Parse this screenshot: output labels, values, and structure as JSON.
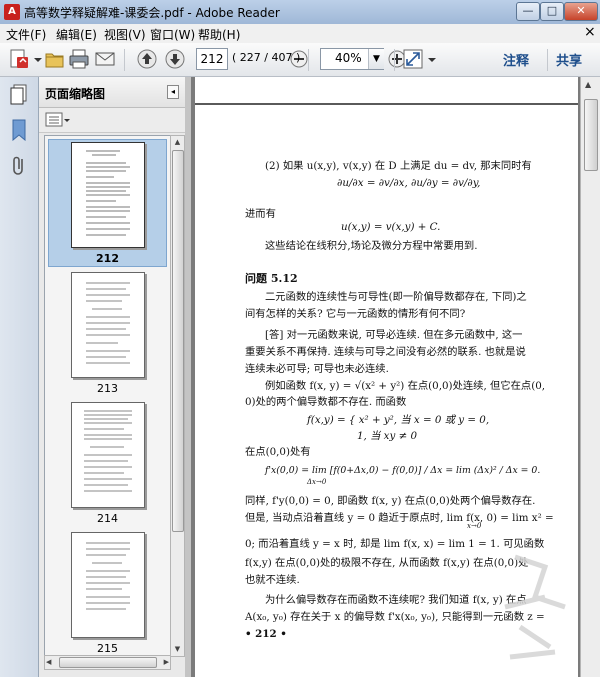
{
  "window": {
    "title": "高等数学释疑解难-课委会.pdf - Adobe Reader",
    "controls": {
      "minimize": "—",
      "maximize": "□",
      "close": "✕"
    }
  },
  "menubar": {
    "items": [
      "文件(F)",
      "编辑(E)",
      "视图(V)",
      "窗口(W)",
      "帮助(H)"
    ],
    "close": "×"
  },
  "toolbar": {
    "page_number": "212",
    "page_count": "( 227 / 407 )",
    "zoom": "40%",
    "annotate": "注释",
    "share": "共享"
  },
  "thumbnail_panel": {
    "title": "页面缩略图",
    "pages": [
      "212",
      "213",
      "214",
      "215"
    ],
    "selected": "212"
  },
  "document": {
    "lines": [
      "(2) 如果 u(x,y), v(x,y) 在 D 上满足 du = dv, 那末同时有",
      "∂u/∂x = ∂v/∂x,  ∂u/∂y = ∂v/∂y,",
      "进而有",
      "u(x,y) = v(x,y) + C.",
      "这些结论在线积分,场论及微分方程中常要用到.",
      "问题 5.12",
      "二元函数的连续性与可导性(即一阶偏导数都存在, 下同)之",
      "间有怎样的关系? 它与一元函数的情形有何不同?",
      "[答]  对一元函数来说, 可导必连续. 但在多元函数中, 这一",
      "重要关系不再保持. 连续与可导之间没有必然的联系. 也就是说",
      "连续未必可导; 可导也未必连续.",
      "例如函数 f(x, y) = √(x² + y²) 在点(0,0)处连续, 但它在点(0,",
      "0)处的两个偏导数都不存在. 而函数",
      "f(x,y) = { x² + y², 当 x = 0 或 y = 0,",
      "1,  当 xy ≠ 0",
      "在点(0,0)处有",
      "f'x(0,0) = lim [f(0+Δx,0) − f(0,0)] / Δx = lim (Δx)² / Δx = 0.",
      "Δx→0",
      "同样, f'y(0,0) = 0, 即函数 f(x, y) 在点(0,0)处两个偏导数存在.",
      "但是, 当动点沿着直线 y = 0 趋近于原点时, lim f(x, 0) = lim x² =",
      "x→0",
      "0; 而沿着直线 y = x 时, 却是 lim f(x, x) = lim 1 = 1. 可见函数",
      "f(x,y) 在点(0,0)处的极限不存在, 从而函数 f(x,y) 在点(0,0)处",
      "也就不连续.",
      "为什么偏导数存在而函数不连续呢? 我们知道 f(x, y) 在点",
      "A(x₀, y₀) 存在关于 x 的偏导数 f'x(x₀, y₀), 只能得到一元函数 z =",
      "• 212 •"
    ]
  }
}
